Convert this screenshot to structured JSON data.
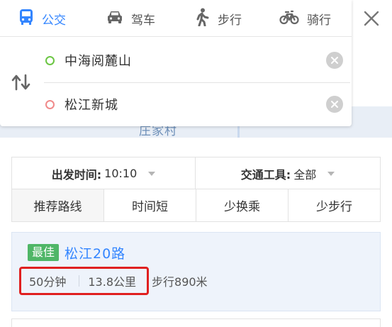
{
  "transport_tabs": [
    {
      "label": "公交",
      "icon": "bus-icon",
      "active": true
    },
    {
      "label": "驾车",
      "icon": "car-icon",
      "active": false
    },
    {
      "label": "步行",
      "icon": "walk-icon",
      "active": false
    },
    {
      "label": "骑行",
      "icon": "bike-icon",
      "active": false
    }
  ],
  "route_inputs": {
    "origin": "中海阅麓山",
    "destination": "松江新城"
  },
  "map_label": "庄家村",
  "filters": {
    "depart_label": "出发时间:",
    "depart_value": "10:10",
    "vehicle_label": "交通工具:",
    "vehicle_value": "全部",
    "options": [
      "推荐路线",
      "时间短",
      "少换乘",
      "少步行"
    ],
    "selected_option": "推荐路线"
  },
  "result": {
    "badge": "最佳",
    "route_name": "松江20路",
    "duration": "50分钟",
    "distance": "13.8公里",
    "walk": "步行890米"
  },
  "colors": {
    "accent": "#3385ff",
    "best_badge": "#4fb667",
    "origin_dot": "#6cc644",
    "destination_dot": "#f08a8a",
    "highlight": "#e02020"
  }
}
